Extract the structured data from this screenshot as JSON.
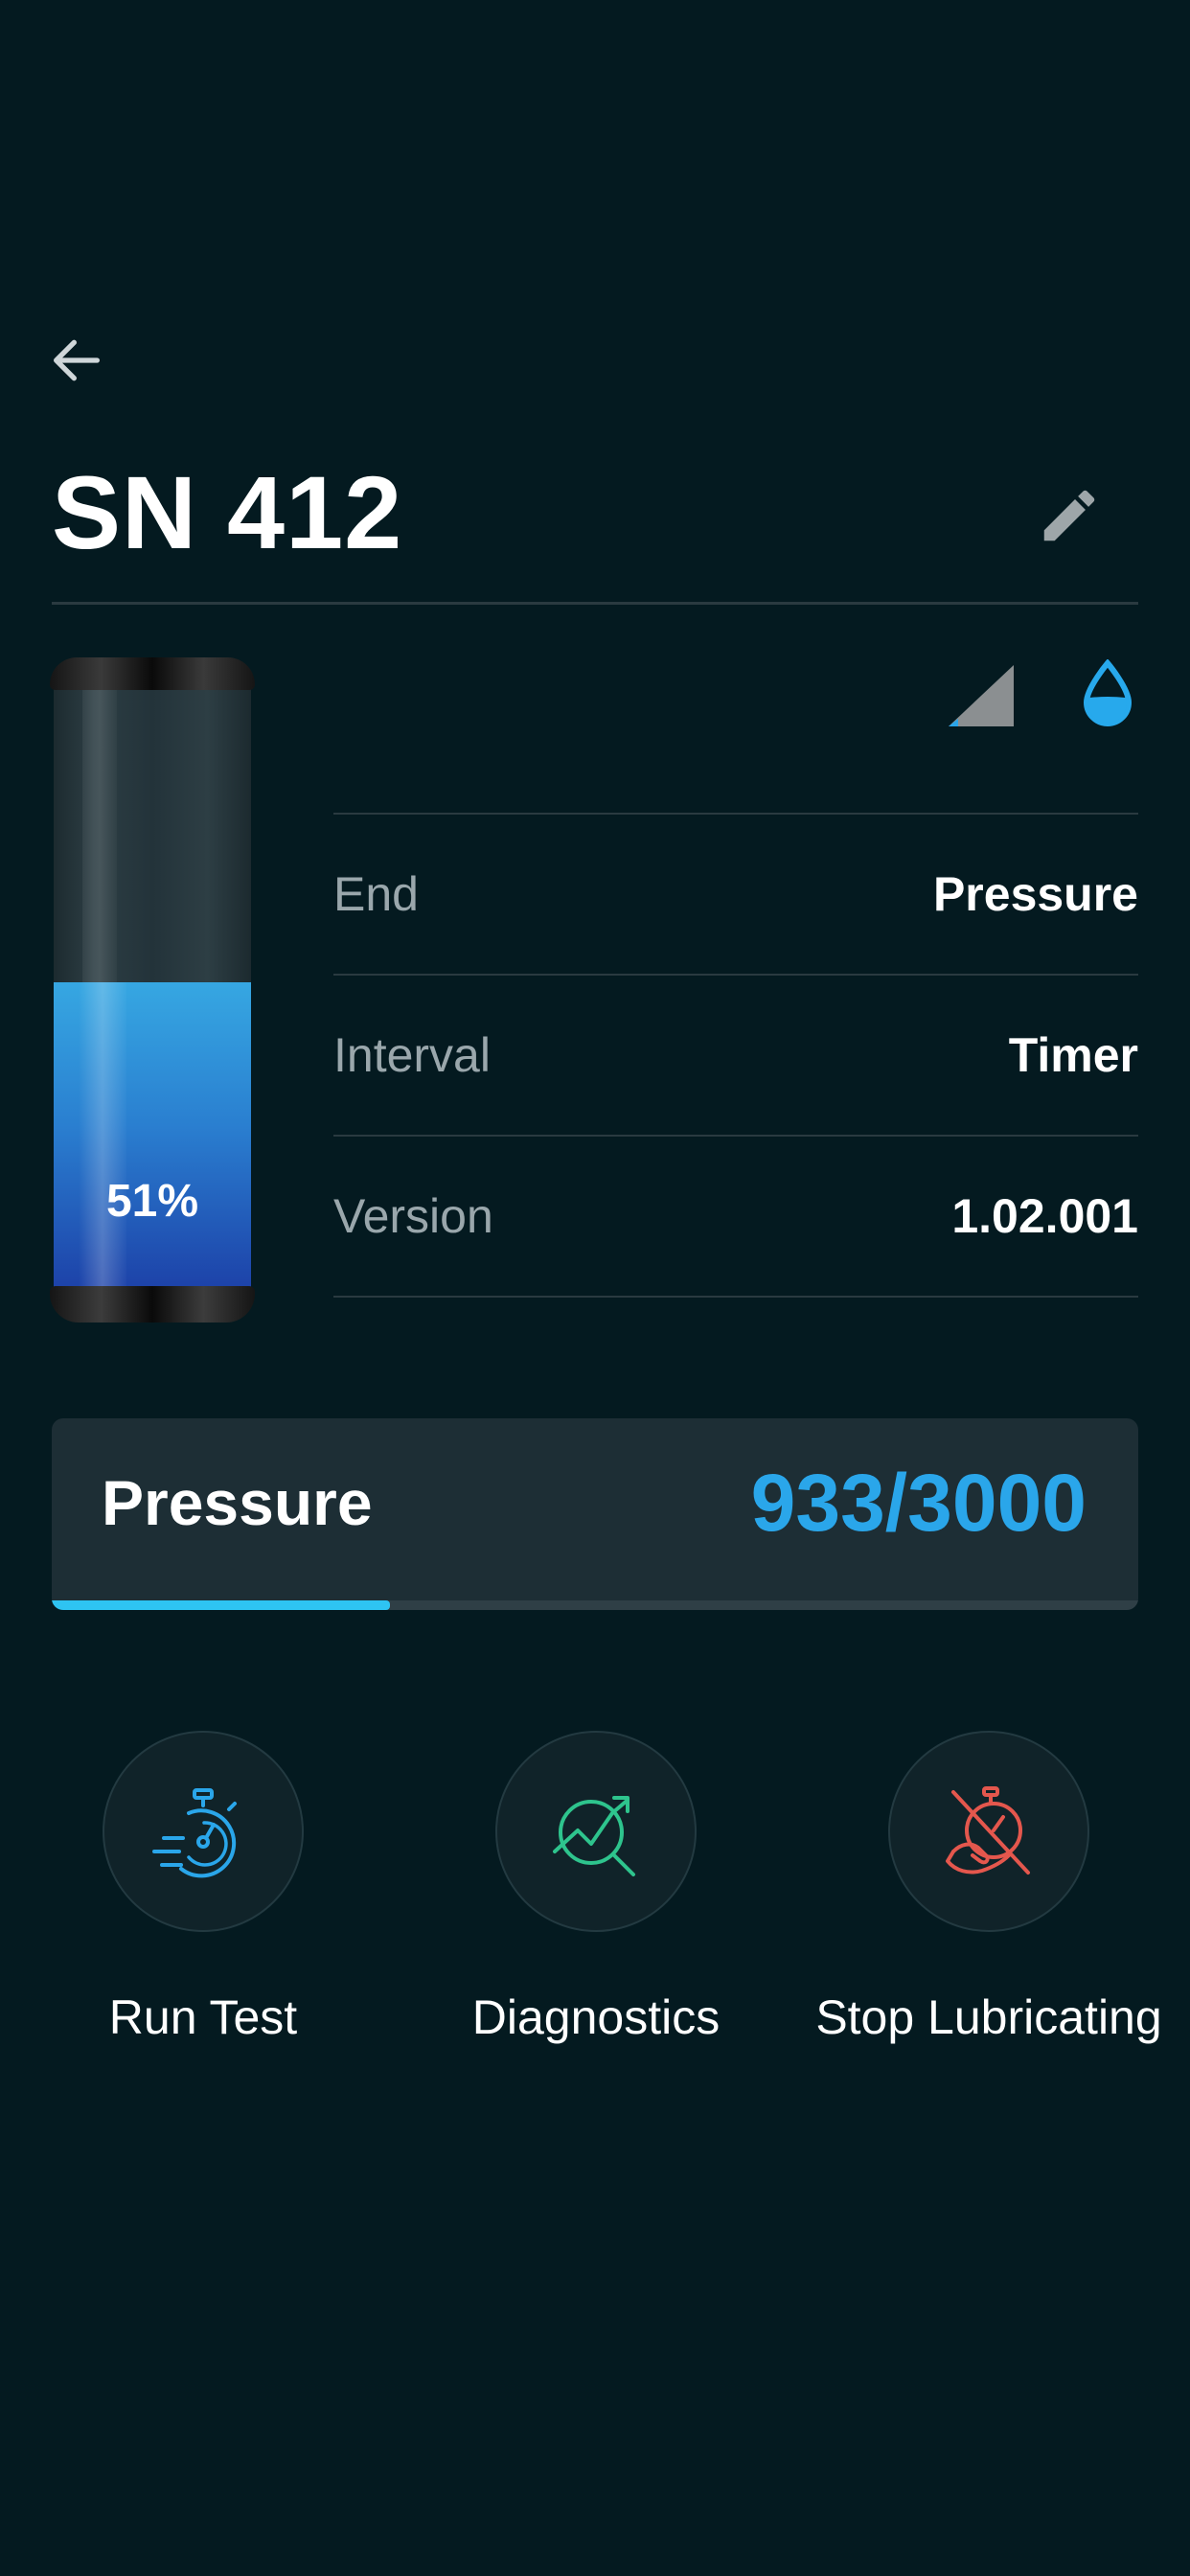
{
  "header": {
    "back_icon": "arrow-left-icon",
    "title": "SN 412",
    "edit_icon": "pencil-icon"
  },
  "cartridge": {
    "level_percent": 51,
    "percent_label": "51%",
    "fill_color": "#2a7fd0"
  },
  "status": {
    "signal_icon": "cellular-signal-icon",
    "lubricant_icon": "water-drop-icon"
  },
  "info": {
    "rows": [
      {
        "label": "End",
        "value": "Pressure"
      },
      {
        "label": "Interval",
        "value": "Timer"
      },
      {
        "label": "Version",
        "value": "1.02.001"
      }
    ]
  },
  "pressure": {
    "label": "Pressure",
    "value_text": "933/3000",
    "current": 933,
    "max": 3000,
    "accent_color": "#2aa6ea"
  },
  "actions": [
    {
      "label": "Run Test",
      "icon": "stopwatch-icon",
      "color": "#2aa6ea"
    },
    {
      "label": "Diagnostics",
      "icon": "chart-search-icon",
      "color": "#2ec48d"
    },
    {
      "label": "Stop Lubricating",
      "icon": "stop-lubricating-icon",
      "color": "#e4574d"
    }
  ]
}
